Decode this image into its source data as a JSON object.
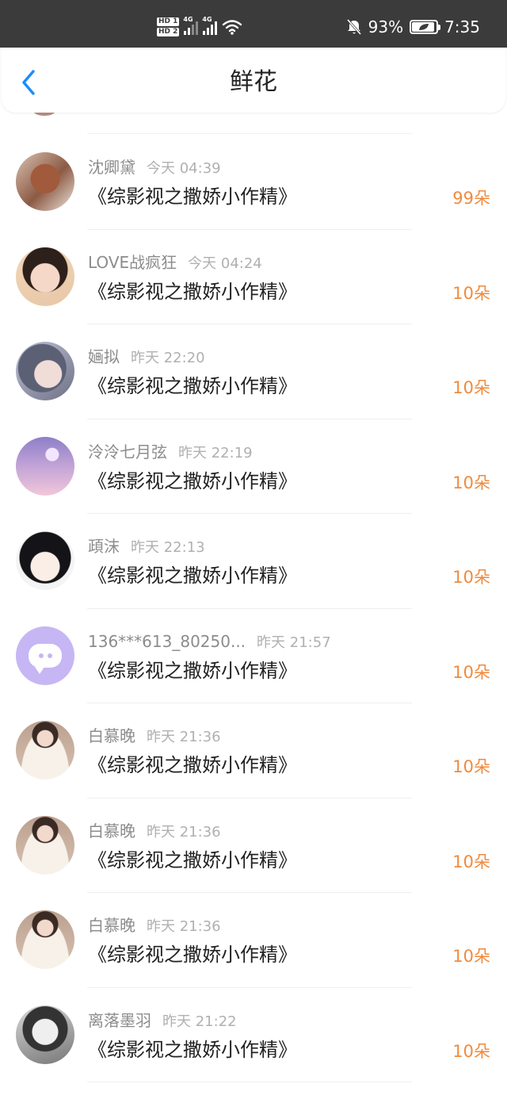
{
  "status_bar": {
    "hd1": "HD 1",
    "hd2": "HD 2",
    "net1": "4G",
    "net2": "4G",
    "battery_percent": "93%",
    "battery_level": 0.93,
    "time": "7:35",
    "icons": [
      "signal-icon",
      "wifi-icon",
      "mute-bell-icon",
      "battery-icon"
    ]
  },
  "header": {
    "title": "鲜花",
    "back_icon": "chevron-left-icon",
    "accent": "#1a8cff"
  },
  "colors": {
    "count": "#f08a3c",
    "name": "#8c8c8c",
    "time": "#b0b0b0"
  },
  "list": [
    {
      "name": "沈卿黛",
      "time": "今天 04:39",
      "book": "《综影视之撒娇小作精》",
      "count": "99朵",
      "avatar": "origami-crane-avatar"
    },
    {
      "name": "LOVE战疯狂",
      "time": "今天 04:24",
      "book": "《综影视之撒娇小作精》",
      "count": "10朵",
      "avatar": "girl-portrait-avatar"
    },
    {
      "name": "婳拟",
      "time": "昨天 22:20",
      "book": "《综影视之撒娇小作精》",
      "count": "10朵",
      "avatar": "illustrated-girl-avatar"
    },
    {
      "name": "泠泠七月弦",
      "time": "昨天 22:19",
      "book": "《综影视之撒娇小作精》",
      "count": "10朵",
      "avatar": "moon-sky-avatar"
    },
    {
      "name": "頙沫",
      "time": "昨天 22:13",
      "book": "《综影视之撒娇小作精》",
      "count": "10朵",
      "avatar": "anime-girl-avatar"
    },
    {
      "name": "136***613_80250...",
      "time": "昨天 21:57",
      "book": "《综影视之撒娇小作精》",
      "count": "10朵",
      "avatar": "default-chat-avatar"
    },
    {
      "name": "白慕晚",
      "time": "昨天 21:36",
      "book": "《综影视之撒娇小作精》",
      "count": "10朵",
      "avatar": "woman-portrait-avatar"
    },
    {
      "name": "白慕晚",
      "time": "昨天 21:36",
      "book": "《综影视之撒娇小作精》",
      "count": "10朵",
      "avatar": "woman-portrait-avatar"
    },
    {
      "name": "白慕晚",
      "time": "昨天 21:36",
      "book": "《综影视之撒娇小作精》",
      "count": "10朵",
      "avatar": "woman-portrait-avatar"
    },
    {
      "name": "离落墨羽",
      "time": "昨天 21:22",
      "book": "《综影视之撒娇小作精》",
      "count": "10朵",
      "avatar": "bw-portrait-avatar"
    }
  ]
}
